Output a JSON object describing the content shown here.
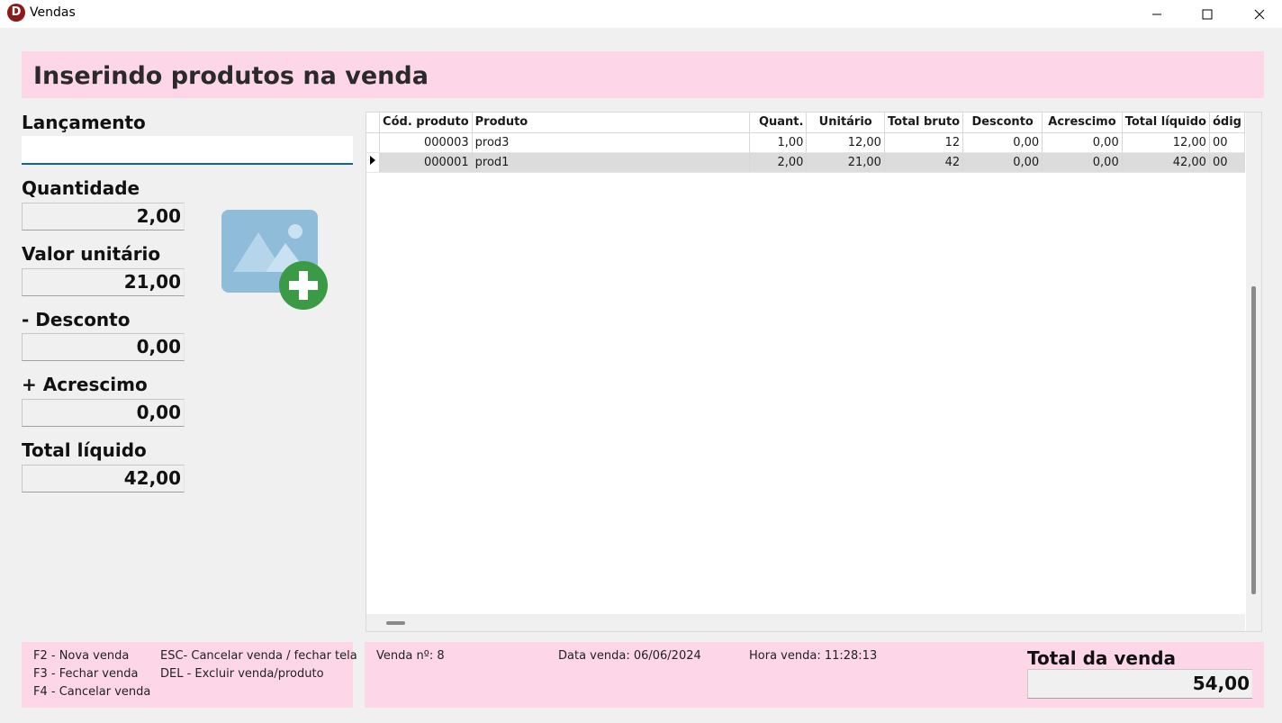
{
  "window": {
    "title": "Vendas",
    "icon_letter": "D"
  },
  "header": {
    "title": "Inserindo produtos na venda"
  },
  "form": {
    "lancamento_label": "Lançamento",
    "lancamento_value": "",
    "quantidade_label": "Quantidade",
    "quantidade_value": "2,00",
    "valor_unitario_label": "Valor unitário",
    "valor_unitario_value": "21,00",
    "desconto_label": "- Desconto",
    "desconto_value": "0,00",
    "acrescimo_label": "+ Acrescimo",
    "acrescimo_value": "0,00",
    "total_liquido_label": "Total líquido",
    "total_liquido_value": "42,00"
  },
  "grid": {
    "columns": [
      "Cód. produto",
      "Produto",
      "Quant.",
      "Unitário",
      "Total bruto",
      "Desconto",
      "Acrescimo",
      "Total líquido",
      "ódig"
    ],
    "rows": [
      {
        "cod": "000003",
        "produto": "prod3",
        "quant": "1,00",
        "unitario": "12,00",
        "total_bruto": "12",
        "desconto": "0,00",
        "acrescimo": "0,00",
        "total_liquido": "12,00",
        "extra": "00"
      },
      {
        "cod": "000001",
        "produto": "prod1",
        "quant": "2,00",
        "unitario": "21,00",
        "total_bruto": "42",
        "desconto": "0,00",
        "acrescimo": "0,00",
        "total_liquido": "42,00",
        "extra": "00"
      }
    ],
    "selected_row": 1
  },
  "shortcuts": {
    "f2": "F2 - Nova venda",
    "f3": "F3 - Fechar venda",
    "f4": "F4 - Cancelar venda",
    "esc": "ESC- Cancelar venda / fechar tela",
    "del": "DEL - Excluir venda/produto"
  },
  "sale": {
    "numero": "Venda nº: 8",
    "data": "Data venda: 06/06/2024",
    "hora": "Hora venda: 11:28:13",
    "total_label": "Total da venda",
    "total_value": "54,00"
  },
  "colors": {
    "banner": "#fdd7e7",
    "accent_blue": "#0a64ad",
    "add_green": "#3a9a45",
    "image_blue": "#8fbcd9"
  }
}
